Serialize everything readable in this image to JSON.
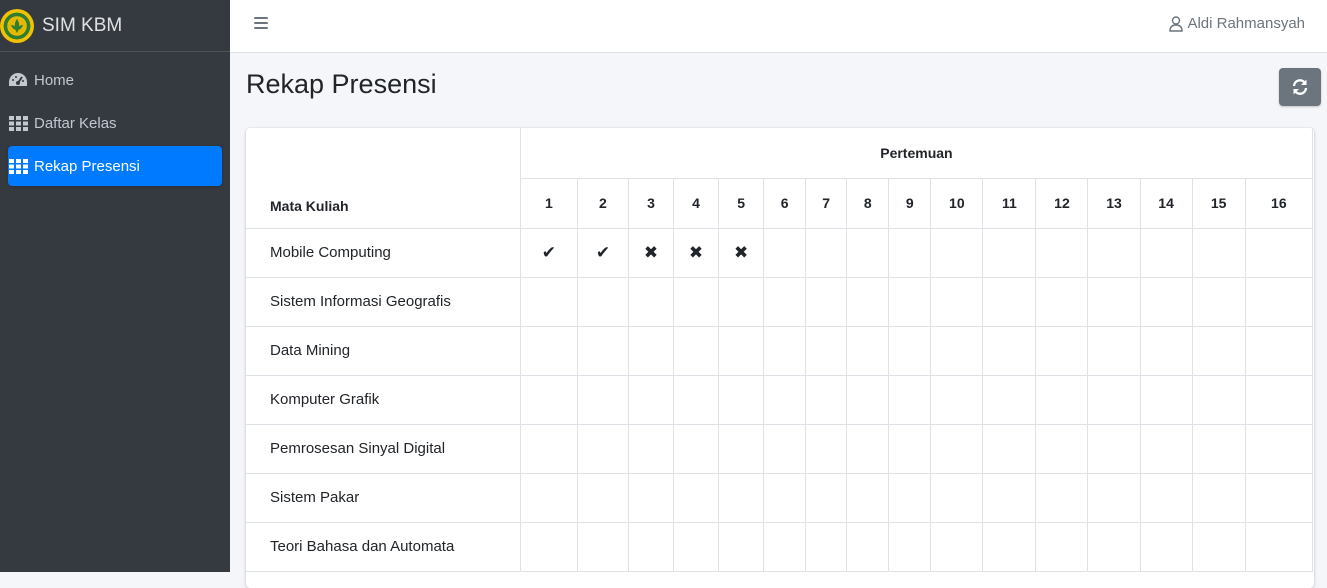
{
  "brand": {
    "title": "SIM KBM"
  },
  "sidebar": {
    "items": [
      {
        "label": "Home",
        "icon": "tachometer-icon",
        "active": false
      },
      {
        "label": "Daftar Kelas",
        "icon": "grid-icon",
        "active": false
      },
      {
        "label": "Rekap Presensi",
        "icon": "grid-icon",
        "active": true
      }
    ]
  },
  "header": {
    "user_name": "Aldi Rahmansyah"
  },
  "page": {
    "title": "Rekap Presensi"
  },
  "table": {
    "subject_header": "Mata Kuliah",
    "meetings_header": "Pertemuan",
    "meetings": [
      "1",
      "2",
      "3",
      "4",
      "5",
      "6",
      "7",
      "8",
      "9",
      "10",
      "11",
      "12",
      "13",
      "14",
      "15",
      "16"
    ],
    "rows": [
      {
        "subject": "Mobile Computing",
        "marks": [
          "✔",
          "✔",
          "✖",
          "✖",
          "✖",
          "",
          "",
          "",
          "",
          "",
          "",
          "",
          "",
          "",
          "",
          ""
        ]
      },
      {
        "subject": "Sistem Informasi Geografis",
        "marks": [
          "",
          "",
          "",
          "",
          "",
          "",
          "",
          "",
          "",
          "",
          "",
          "",
          "",
          "",
          "",
          ""
        ]
      },
      {
        "subject": "Data Mining",
        "marks": [
          "",
          "",
          "",
          "",
          "",
          "",
          "",
          "",
          "",
          "",
          "",
          "",
          "",
          "",
          "",
          ""
        ]
      },
      {
        "subject": "Komputer Grafik",
        "marks": [
          "",
          "",
          "",
          "",
          "",
          "",
          "",
          "",
          "",
          "",
          "",
          "",
          "",
          "",
          "",
          ""
        ]
      },
      {
        "subject": "Pemrosesan Sinyal Digital",
        "marks": [
          "",
          "",
          "",
          "",
          "",
          "",
          "",
          "",
          "",
          "",
          "",
          "",
          "",
          "",
          "",
          ""
        ]
      },
      {
        "subject": "Sistem Pakar",
        "marks": [
          "",
          "",
          "",
          "",
          "",
          "",
          "",
          "",
          "",
          "",
          "",
          "",
          "",
          "",
          "",
          ""
        ]
      },
      {
        "subject": "Teori Bahasa dan Automata",
        "marks": [
          "",
          "",
          "",
          "",
          "",
          "",
          "",
          "",
          "",
          "",
          "",
          "",
          "",
          "",
          "",
          ""
        ]
      }
    ]
  },
  "colors": {
    "sidebar_bg": "#343a40",
    "active": "#007bff",
    "refresh_btn": "#6c757d"
  }
}
